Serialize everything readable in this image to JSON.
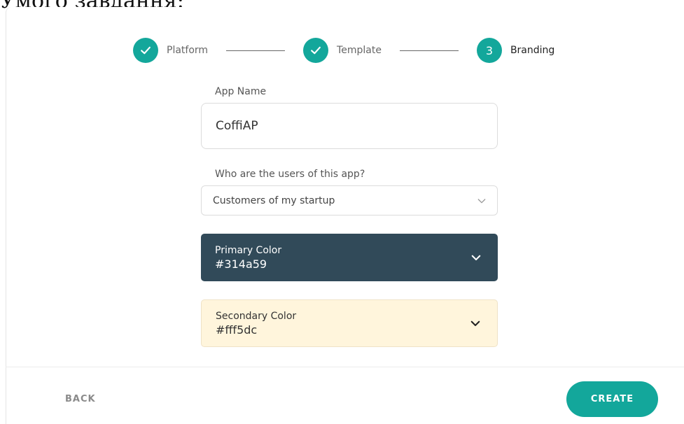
{
  "top_text": "Умого завдання:",
  "stepper": {
    "steps": [
      {
        "label": "Platform",
        "state": "completed"
      },
      {
        "label": "Template",
        "state": "completed"
      },
      {
        "label": "Branding",
        "state": "active",
        "number": "3"
      }
    ],
    "accent": "#13a79b"
  },
  "form": {
    "app_name": {
      "label": "App Name",
      "value": "CoffiAP"
    },
    "users": {
      "label": "Who are the users of this app?",
      "selected": "Customers of my startup"
    },
    "primary_color": {
      "label": "Primary Color",
      "value": "#314a59",
      "text_color": "#ffffff"
    },
    "secondary_color": {
      "label": "Secondary Color",
      "value": "#fff5dc",
      "text_color": "#333333"
    }
  },
  "footer": {
    "back_label": "BACK",
    "create_label": "CREATE"
  }
}
